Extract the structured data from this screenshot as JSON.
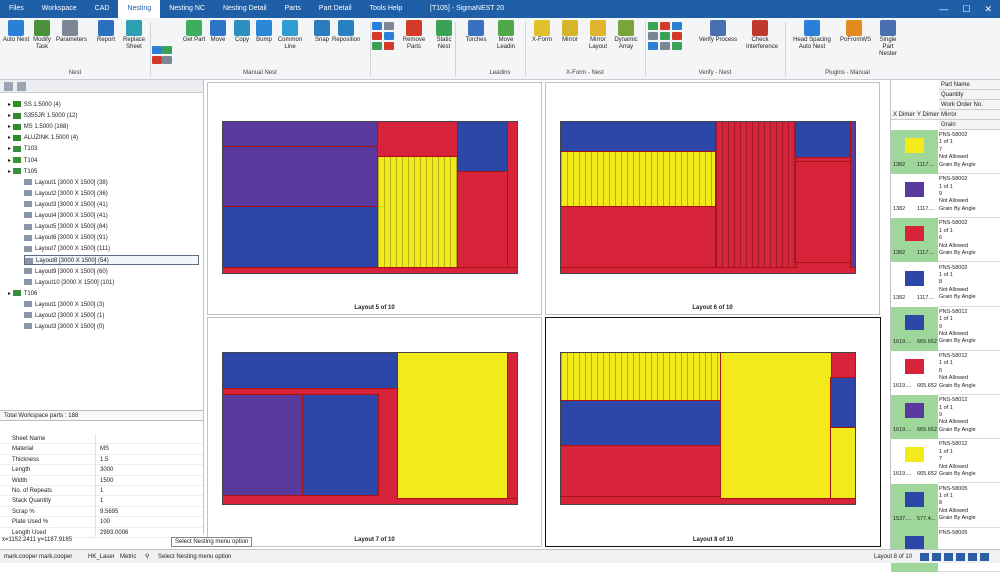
{
  "window": {
    "title": "[T105] - SigmaNEST 20",
    "controls": [
      "—",
      "☐",
      "✕"
    ]
  },
  "menus": [
    "Files",
    "Workspace",
    "CAD",
    "Nesting",
    "Nesting NC",
    "Nesting Detail",
    "Parts",
    "Part Detail",
    "Tools Help"
  ],
  "ribbon": {
    "buttons": [
      {
        "label": "Auto Nest",
        "color": "#2a7fd6"
      },
      {
        "label": "Modify Task",
        "color": "#4a8f3a"
      },
      {
        "label": "Parameters",
        "color": "#7c8796"
      },
      {
        "label": "Report",
        "color": "#2a6fc0"
      },
      {
        "label": "Replace Sheet",
        "color": "#2c9fb0"
      },
      {
        "label": "Get Part",
        "color": "#3cae5e"
      },
      {
        "label": "Move",
        "color": "#2e74c8"
      },
      {
        "label": "Copy",
        "color": "#2d8fc0"
      },
      {
        "label": "Bump",
        "color": "#2a86d6"
      },
      {
        "label": "Common Line",
        "color": "#2e9ed0"
      },
      {
        "label": "Snap",
        "color": "#2a7cbf"
      },
      {
        "label": "Reposition",
        "color": "#2680c2"
      },
      {
        "label": "Remove Parts",
        "color": "#d43a2a"
      },
      {
        "label": "Static Nest",
        "color": "#3aa256"
      },
      {
        "label": "Torches",
        "color": "#3a6fc0"
      },
      {
        "label": "Move Leadin",
        "color": "#4fa84a"
      },
      {
        "label": "X-Form",
        "color": "#e1c22b"
      },
      {
        "label": "Mirror",
        "color": "#d6b52a"
      },
      {
        "label": "Mirror Layout",
        "color": "#e1b52b"
      },
      {
        "label": "Dynamic Array",
        "color": "#7aa33a"
      },
      {
        "label": "Verify Process",
        "color": "#4a6fb0"
      },
      {
        "label": "Check Interference",
        "color": "#c0392b"
      },
      {
        "label": "Head Spacing Auto Nest",
        "color": "#2a7fd6"
      },
      {
        "label": "PoFromWS",
        "color": "#e48a1c"
      },
      {
        "label": "Single Part Nester",
        "color": "#4a6fb0"
      }
    ],
    "groups": [
      "Nest",
      "Manual Nest",
      "Leadins",
      "X-Form - Nest",
      "Verify - Nest",
      "Plugins - Manual"
    ]
  },
  "tree": {
    "items": [
      {
        "label": "SS 1.5000 (4)",
        "level": 0,
        "icon": "material-icon"
      },
      {
        "label": "S355JR 1.5000 (12)",
        "level": 0,
        "icon": "material-icon"
      },
      {
        "label": "MS 1.5000 (168)",
        "level": 0,
        "icon": "material-icon"
      },
      {
        "label": "ALUZINK 1.5000 (4)",
        "level": 0,
        "icon": "material-icon"
      },
      {
        "label": "T103",
        "level": 0,
        "icon": "task-icon"
      },
      {
        "label": "T104",
        "level": 0,
        "icon": "task-icon"
      },
      {
        "label": "T105",
        "level": 0,
        "icon": "task-icon"
      },
      {
        "label": "Layout1 [3000 X 1500] (38)",
        "level": 1,
        "icon": "layout-icon"
      },
      {
        "label": "Layout2 [3000 X 1500] (36)",
        "level": 1,
        "icon": "layout-icon"
      },
      {
        "label": "Layout3 [3000 X 1500] (41)",
        "level": 1,
        "icon": "layout-icon"
      },
      {
        "label": "Layout4 [3000 X 1500] (41)",
        "level": 1,
        "icon": "layout-icon"
      },
      {
        "label": "Layout5 [3000 X 1500] (84)",
        "level": 1,
        "icon": "layout-icon"
      },
      {
        "label": "Layout6 [3000 X 1500] (91)",
        "level": 1,
        "icon": "layout-icon"
      },
      {
        "label": "Layout7 [3000 X 1500] (111)",
        "level": 1,
        "icon": "layout-icon"
      },
      {
        "label": "Layout8 [3000 X 1500] (54)",
        "level": 1,
        "icon": "layout-icon",
        "selected": true
      },
      {
        "label": "Layout9 [3000 X 1500] (60)",
        "level": 1,
        "icon": "layout-icon"
      },
      {
        "label": "Layout10 [3000 X 1500] (101)",
        "level": 1,
        "icon": "layout-icon"
      },
      {
        "label": "T106",
        "level": 0,
        "icon": "task-icon"
      },
      {
        "label": "Layout1 [3000 X 1500] (3)",
        "level": 1,
        "icon": "layout-icon"
      },
      {
        "label": "Layout2 [3000 X 1500] (1)",
        "level": 1,
        "icon": "layout-icon"
      },
      {
        "label": "Layout3 [3000 X 1500] (0)",
        "level": 1,
        "icon": "layout-icon"
      }
    ]
  },
  "total_parts": "Total Workspace parts : 188",
  "properties": [
    {
      "k": "Sheet Name",
      "v": ""
    },
    {
      "k": "Material",
      "v": "MS"
    },
    {
      "k": "Thickness",
      "v": "1.5"
    },
    {
      "k": "Length",
      "v": "3000"
    },
    {
      "k": "Width",
      "v": "1500"
    },
    {
      "k": "No. of Repeats",
      "v": "1"
    },
    {
      "k": "Stack Quantity",
      "v": "1"
    },
    {
      "k": "Scrap %",
      "v": "9.5695"
    },
    {
      "k": "Plate Used %",
      "v": "100"
    },
    {
      "k": "Length Used",
      "v": "2993.0006"
    }
  ],
  "coords": "x=1152.2411 y=1187.9185",
  "tooltip": "Select Nesting menu option",
  "layouts": [
    "Layout 5 of 10",
    "Layout 6 of 10",
    "Layout 7 of 10",
    "Layout 8 of 10"
  ],
  "part_headers": {
    "col1": "X Dimen",
    "col2": "Y Dimen",
    "rows": [
      "Part Name",
      "Quantity",
      "Work Order No.",
      "Mirror",
      "Grain"
    ]
  },
  "parts": [
    {
      "name": "PNS-58002",
      "qty": "1 of 1",
      "wo": "7",
      "mirror": "Not Allowed",
      "grain": "Grain By Angle",
      "x": "1382",
      "y": "1117....",
      "color": "#f3ea1c",
      "sel": true
    },
    {
      "name": "PNS-58002",
      "qty": "1 of 1",
      "wo": "9",
      "mirror": "Not Allowed",
      "grain": "Grain By Angle",
      "x": "1382",
      "y": "1117....",
      "color": "#5a3a9c"
    },
    {
      "name": "PNS-58002",
      "qty": "1 of 1",
      "wo": "6",
      "mirror": "Not Allowed",
      "grain": "Grain By Angle",
      "x": "1382",
      "y": "1117....",
      "color": "#d7243a",
      "sel": true
    },
    {
      "name": "PNS-58002",
      "qty": "1 of 1",
      "wo": "8",
      "mirror": "Not Allowed",
      "grain": "Grain By Angle",
      "x": "1382",
      "y": "1117....",
      "color": "#2d47a8"
    },
    {
      "name": "PNS-58012",
      "qty": "1 of 1",
      "wo": "9",
      "mirror": "Not Allowed",
      "grain": "Grain By Angle",
      "x": "1619....",
      "y": "665.652",
      "color": "#2d47a8",
      "sel": true
    },
    {
      "name": "PNS-58012",
      "qty": "1 of 1",
      "wo": "6",
      "mirror": "Not Allowed",
      "grain": "Grain By Angle",
      "x": "1619....",
      "y": "665.652",
      "color": "#d7243a"
    },
    {
      "name": "PNS-58012",
      "qty": "1 of 1",
      "wo": "9",
      "mirror": "Not Allowed",
      "grain": "Grain By Angle",
      "x": "1619....",
      "y": "665.652",
      "color": "#5a3a9c",
      "sel": true
    },
    {
      "name": "PNS-58012",
      "qty": "1 of 1",
      "wo": "7",
      "mirror": "Not Allowed",
      "grain": "Grain By Angle",
      "x": "1619....",
      "y": "665.652",
      "color": "#f3ea1c"
    },
    {
      "name": "PNS-58005",
      "qty": "1 of 1",
      "wo": "8",
      "mirror": "Not Allowed",
      "grain": "Grain By Angle",
      "x": "1537....",
      "y": "577.4...",
      "color": "#2d47a8",
      "sel": true
    },
    {
      "name": "PNS-58005",
      "qty": "",
      "wo": "",
      "mirror": "",
      "grain": "",
      "x": "",
      "y": "",
      "color": "#2d47a8",
      "sel": true
    }
  ],
  "status": {
    "users": "mark.cooper mark.cooper",
    "machine": "HK_Laser",
    "units": "Metric",
    "hint": "Select Nesting menu option",
    "layout": "Layout 8 of 10"
  }
}
